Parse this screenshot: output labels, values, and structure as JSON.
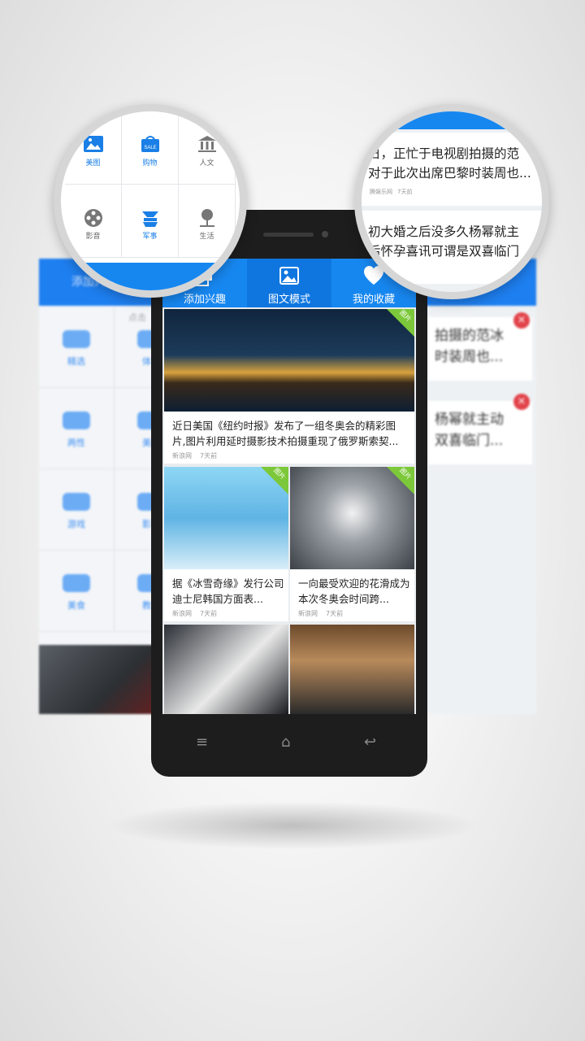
{
  "app": {
    "tabs": [
      {
        "label": "添加兴趣",
        "icon": "add-interest-icon"
      },
      {
        "label": "图文模式",
        "icon": "image-mode-icon"
      },
      {
        "label": "我的收藏",
        "icon": "heart-icon"
      }
    ],
    "accent_color": "#1787f0"
  },
  "feed": [
    {
      "title": "近日美国《纽约时报》发布了一组冬奥会的精彩图片,图片利用延时摄影技术拍摄重现了俄罗斯索契...",
      "source": "新浪网",
      "time": "7天前"
    },
    {
      "title": "据《冰雪奇缘》发行公司迪士尼韩国方面表...",
      "source": "新浪网",
      "time": "7天前"
    },
    {
      "title": "一向最受欢迎的花滑成为本次冬奥会时间跨...",
      "source": "新浪网",
      "time": "7天前"
    }
  ],
  "left_magnifier": {
    "categories": [
      {
        "label": "美图",
        "icon": "picture-icon"
      },
      {
        "label": "购物",
        "icon": "sale-bag-icon"
      },
      {
        "label": "人文",
        "icon": "museum-icon"
      },
      {
        "label": "影音",
        "icon": "film-reel-icon"
      },
      {
        "label": "军事",
        "icon": "military-icon"
      },
      {
        "label": "生活",
        "icon": "tree-icon"
      }
    ]
  },
  "right_magnifier": {
    "lines": [
      {
        "text": "日，正忙于电视剧拍摄的范"
      },
      {
        "text": "对于此次出席巴黎时装周也..."
      },
      {
        "text": "初大婚之后没多久杨幂就主"
      },
      {
        "text": "后怀孕喜讯可谓是双喜临门"
      }
    ],
    "meta_source": "腾娱乐网",
    "meta_time": "7天前"
  },
  "background_left": {
    "header": "添加兴趣",
    "hint": "点击",
    "cells": [
      "精选",
      "两性",
      "游戏",
      "美食",
      "体育",
      "美图",
      "影音",
      "教育"
    ]
  },
  "background_right": {
    "cards": [
      {
        "line1": "拍摄的范冰",
        "line2": "时装周也..."
      },
      {
        "line1": "杨幂就主动",
        "line2": "双喜临门..."
      }
    ],
    "badge": "×"
  },
  "badges": {
    "feed_corner": "图片"
  },
  "nav": {
    "menu": "≡",
    "home": "⌂",
    "back": "↩"
  }
}
